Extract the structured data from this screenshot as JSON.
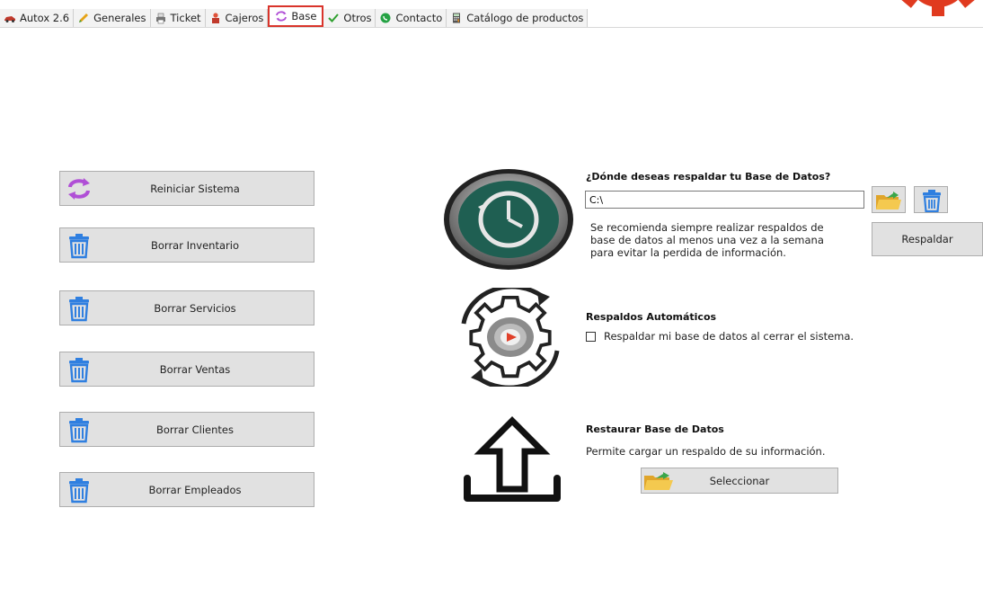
{
  "tabs": [
    {
      "label": "Autox 2.6",
      "icon": "car-icon"
    },
    {
      "label": "Generales",
      "icon": "pencil-icon"
    },
    {
      "label": "Ticket",
      "icon": "printer-icon"
    },
    {
      "label": "Cajeros",
      "icon": "cashier-icon"
    },
    {
      "label": "Base",
      "icon": "refresh-icon",
      "active": true
    },
    {
      "label": "Otros",
      "icon": "check-icon"
    },
    {
      "label": "Contacto",
      "icon": "whatsapp-icon"
    },
    {
      "label": "Catálogo de productos",
      "icon": "calculator-icon"
    }
  ],
  "left_buttons": [
    {
      "label": "Reiniciar Sistema",
      "icon": "refresh-icon"
    },
    {
      "label": "Borrar Inventario",
      "icon": "trash-icon"
    },
    {
      "label": "Borrar Servicios",
      "icon": "trash-icon"
    },
    {
      "label": "Borrar Ventas",
      "icon": "trash-icon"
    },
    {
      "label": "Borrar Clientes",
      "icon": "trash-icon"
    },
    {
      "label": "Borrar Empleados",
      "icon": "trash-icon"
    }
  ],
  "backup": {
    "heading": "¿Dónde deseas respaldar tu Base de Datos?",
    "path_value": "C:\\",
    "note_line1": "Se recomienda siempre realizar respaldos de",
    "note_line2": "base de datos al menos una vez a la semana",
    "note_line3": "para evitar la perdida de información.",
    "button_label": "Respaldar"
  },
  "auto": {
    "heading": "Respaldos Automáticos",
    "checkbox_label": "Respaldar mi base de datos al cerrar el sistema.",
    "checked": false
  },
  "restore": {
    "heading": "Restaurar Base de Datos",
    "description": "Permite cargar un respaldo de su información.",
    "button_label": "Seleccionar"
  },
  "colors": {
    "active_tab_border": "#d9342b",
    "trash_blue": "#2f7fe0",
    "refresh_purple": "#b04fd6",
    "clock_green": "#1f5f52"
  }
}
